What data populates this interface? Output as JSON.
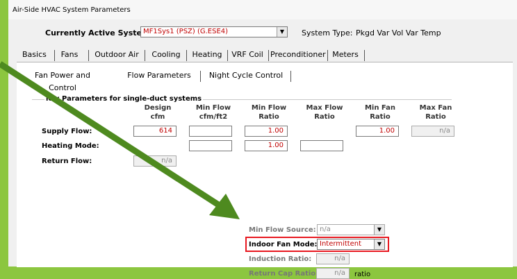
{
  "window": {
    "title": "Air-Side HVAC System Parameters"
  },
  "system": {
    "label": "Currently Active System:",
    "value": "MF1Sys1 (PSZ) (G.ESE4)",
    "type_label": "System Type:",
    "type_value": "Pkgd Var Vol Var Temp"
  },
  "tabs": [
    "Basics",
    "Fans",
    "Outdoor Air",
    "Cooling",
    "Heating",
    "VRF Coil",
    "Preconditioner",
    "Meters"
  ],
  "active_tab": "Fans",
  "subtabs": [
    "Fan Power and Control",
    "Flow Parameters",
    "Night Cycle Control"
  ],
  "active_subtab": "Flow Parameters",
  "group": {
    "title": "Flow Parameters for single-duct systems",
    "visible_title": "low Parameters for single-duct systems",
    "columns": [
      {
        "line1": "Design",
        "line2": "cfm"
      },
      {
        "line1": "Min Flow",
        "line2": "cfm/ft2"
      },
      {
        "line1": "Min Flow",
        "line2": "Ratio"
      },
      {
        "line1": "Max Flow",
        "line2": "Ratio"
      },
      {
        "line1": "Min Fan",
        "line2": "Ratio"
      },
      {
        "line1": "Max Fan",
        "line2": "Ratio"
      }
    ],
    "rows": {
      "supply": {
        "label": "Supply Flow:",
        "design": "614",
        "min_flow_cfm": "",
        "min_flow_ratio": "1.00",
        "min_fan_ratio": "1.00",
        "max_fan_ratio": "n/a"
      },
      "heating": {
        "label": "Heating Mode:",
        "min_flow_cfm": "",
        "min_flow_ratio": "1.00",
        "max_flow_ratio": ""
      },
      "return": {
        "label": "Return Flow:",
        "design": "n/a"
      }
    }
  },
  "lower": {
    "min_flow_source": {
      "label": "Min Flow Source:",
      "value": "n/a"
    },
    "indoor_fan_mode": {
      "label": "Indoor Fan Mode:",
      "value": "Intermittent"
    },
    "induction_ratio": {
      "label": "Induction Ratio:",
      "value": "n/a"
    },
    "return_cap_ratio": {
      "label": "Return Cap Ratio:",
      "value": "n/a",
      "unit": "ratio"
    }
  },
  "colors": {
    "arrow": "#4e8a1f",
    "highlight": "#e8171f",
    "value_text": "#c00000",
    "background": "#8cc63f"
  }
}
